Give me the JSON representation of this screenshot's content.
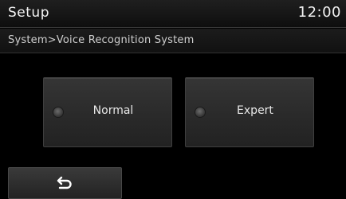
{
  "header": {
    "title": "Setup",
    "clock": "12:00"
  },
  "breadcrumb": {
    "text": "System>Voice Recognition System"
  },
  "options": [
    {
      "label": "Normal",
      "selected": false
    },
    {
      "label": "Expert",
      "selected": false
    }
  ],
  "footer": {
    "back_icon": "back-arrow-icon"
  },
  "colors": {
    "background": "#000000",
    "button": "#2c2c2c",
    "text": "#f2f2f2"
  }
}
